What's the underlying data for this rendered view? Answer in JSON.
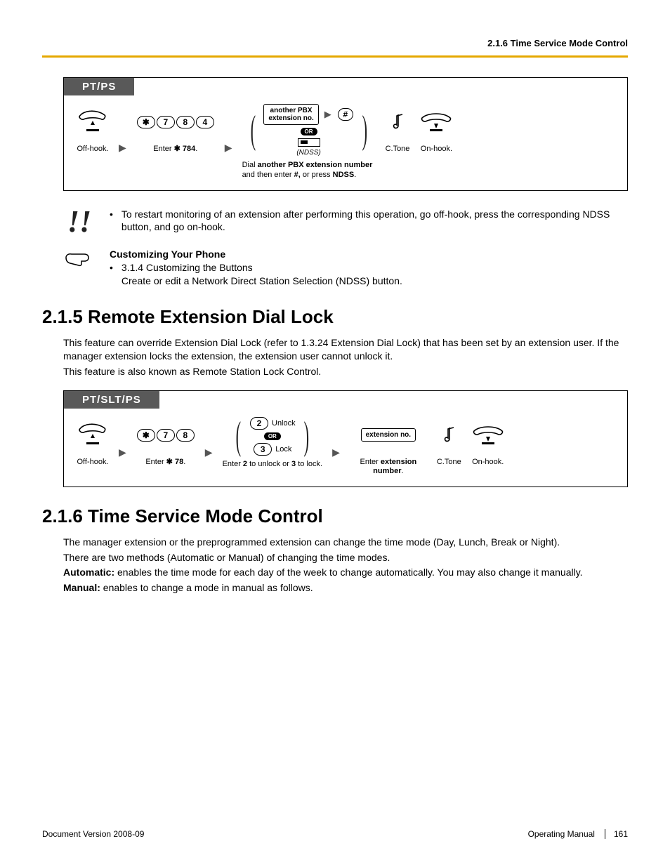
{
  "header": {
    "right": "2.1.6 Time Service Mode Control"
  },
  "diagram1": {
    "tab": "PT/PS",
    "step1_caption": "Off-hook.",
    "keys": [
      "✱",
      "7",
      "8",
      "4"
    ],
    "step2_caption_prefix": "Enter ",
    "step2_caption_code": "✱ 784",
    "step2_caption_suffix": ".",
    "choice_top": "another PBX\nextension no.",
    "or": "OR",
    "ndss_label": "(NDSS)",
    "hash": "#",
    "step3_caption": "Dial  another PBX extension number and then enter #, or press NDSS.",
    "step3_caption_parts": {
      "pre": "Dial ",
      "b1": "another PBX extension number",
      "mid1": " and then enter ",
      "b2": "#,",
      "mid2": " or press ",
      "b3": "NDSS",
      "post": "."
    },
    "ctone": "C.Tone",
    "onhook": "On-hook."
  },
  "note1": {
    "text": "To restart monitoring of an extension after performing this operation, go off-hook, press the corresponding NDSS button, and go on-hook."
  },
  "note2": {
    "heading": "Customizing Your Phone",
    "item1": "3.1.4  Customizing the Buttons",
    "item2": "Create or edit a Network Direct Station Selection (NDSS) button."
  },
  "sec215": {
    "title": "2.1.5  Remote Extension Dial Lock",
    "p1": "This feature can override Extension Dial Lock (refer to 1.3.24  Extension Dial Lock) that has been set by an extension user. If the manager extension locks the extension, the extension user cannot unlock it.",
    "p2": "This feature is also known as Remote Station Lock Control."
  },
  "diagram2": {
    "tab": "PT/SLT/PS",
    "step1_caption": "Off-hook.",
    "keys": [
      "✱",
      "7",
      "8"
    ],
    "step2_caption_prefix": "Enter ",
    "step2_caption_code": "✱ 78",
    "step2_caption_suffix": ".",
    "unlock_key": "2",
    "unlock_label": "Unlock",
    "or": "OR",
    "lock_key": "3",
    "lock_label": "Lock",
    "step3_caption_parts": {
      "pre": "Enter ",
      "b1": "2",
      "mid1": " to unlock or ",
      "b2": "3",
      "mid2": " to lock."
    },
    "ext_box": "extension no.",
    "step4_caption_parts": {
      "pre": "Enter ",
      "b1": "extension number",
      "post": "."
    },
    "ctone": "C.Tone",
    "onhook": "On-hook."
  },
  "sec216": {
    "title": "2.1.6  Time Service Mode Control",
    "p1": "The manager extension or the preprogrammed extension can change the time mode (Day, Lunch, Break or Night).",
    "p2": "There are two methods (Automatic or Manual) of changing the time modes.",
    "p3_b": "Automatic:",
    "p3": " enables the time mode for each day of the week to change automatically. You may also change it manually.",
    "p4_b": "Manual:",
    "p4": " enables to change a mode in manual as follows."
  },
  "footer": {
    "left": "Document Version  2008-09",
    "right_label": "Operating Manual",
    "page": "161"
  }
}
